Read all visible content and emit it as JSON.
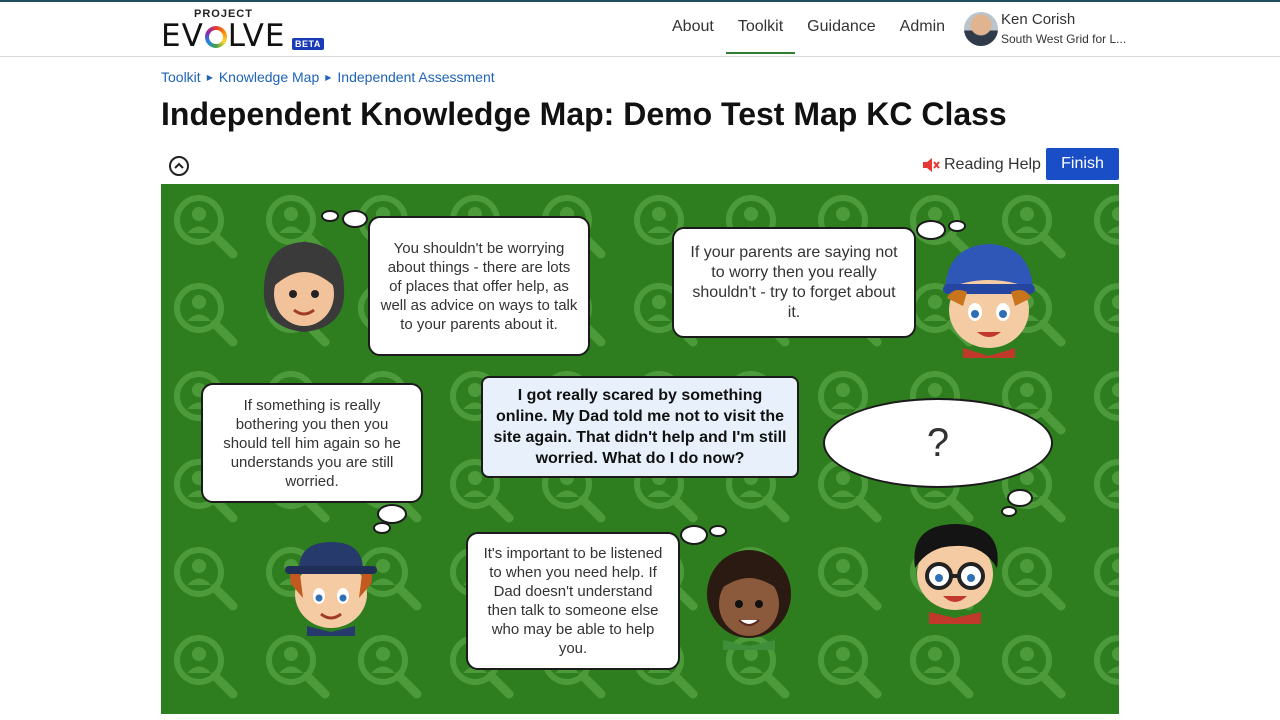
{
  "header": {
    "logo": {
      "top": "PROJECT",
      "main": "EVOLVE",
      "badge": "BETA"
    },
    "nav": [
      {
        "label": "About"
      },
      {
        "label": "Toolkit",
        "active": true
      },
      {
        "label": "Guidance"
      },
      {
        "label": "Admin"
      }
    ],
    "user": {
      "name": "Ken Corish",
      "org": "South West Grid for L..."
    }
  },
  "breadcrumb": [
    "Toolkit",
    "Knowledge Map",
    "Independent Assessment"
  ],
  "page_title": "Independent Knowledge Map: Demo Test Map KC Class",
  "toolbar": {
    "reading_help": "Reading Help",
    "finish": "Finish"
  },
  "activity": {
    "question": "I got really scared by something online. My Dad told me not to visit the site again. That didn't help and I'm still worried. What do I do now?",
    "answers": [
      "You shouldn't be worrying about things - there are lots of places that offer help, as well as advice on ways to talk to your parents about it.",
      "If your parents are saying not to worry then you really shouldn't - try to forget about it.",
      "If something is really bothering you then you should tell him again so he understands you are still worried.",
      "It's important to be listened to when you need help. If Dad doesn't understand then talk to someone else who may be able to help you."
    ],
    "placeholder": "?"
  },
  "colors": {
    "stage_green": "#2e7d1e",
    "finish_blue": "#1a4ec7",
    "link_blue": "#1e63b8"
  }
}
